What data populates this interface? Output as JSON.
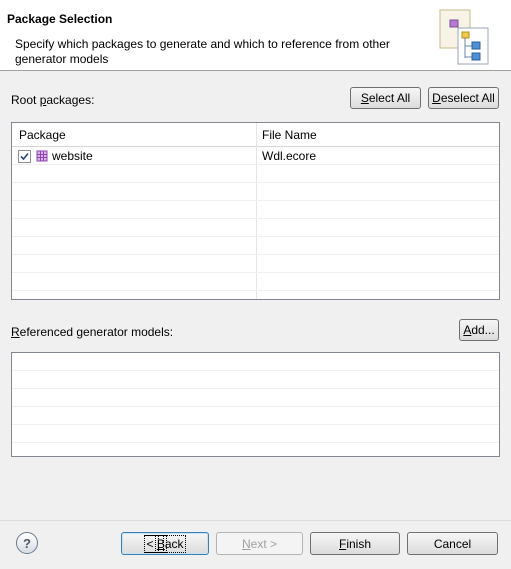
{
  "header": {
    "title": "Package Selection",
    "description": "Specify which packages to generate and which to reference from other generator models"
  },
  "root_packages": {
    "label_underlined": "p",
    "label_before": "Root ",
    "label_after": "ackages:",
    "select_all_ul": "S",
    "select_all_rest": "elect All",
    "deselect_all_ul": "D",
    "deselect_all_rest": "eselect All",
    "columns": [
      "Package",
      "File Name"
    ],
    "rows": [
      {
        "package": "website",
        "file": "Wdl.ecore",
        "checked": true
      }
    ]
  },
  "referenced": {
    "label_ul": "R",
    "label_rest": "eferenced generator models:",
    "add_ul": "A",
    "add_rest": "dd..."
  },
  "footer": {
    "help": "?",
    "back_prefix": "< ",
    "back_ul": "B",
    "back_rest": "ack",
    "next_ul": "N",
    "next_rest": "ext >",
    "finish_ul": "F",
    "finish_rest": "inish",
    "cancel": "Cancel"
  }
}
